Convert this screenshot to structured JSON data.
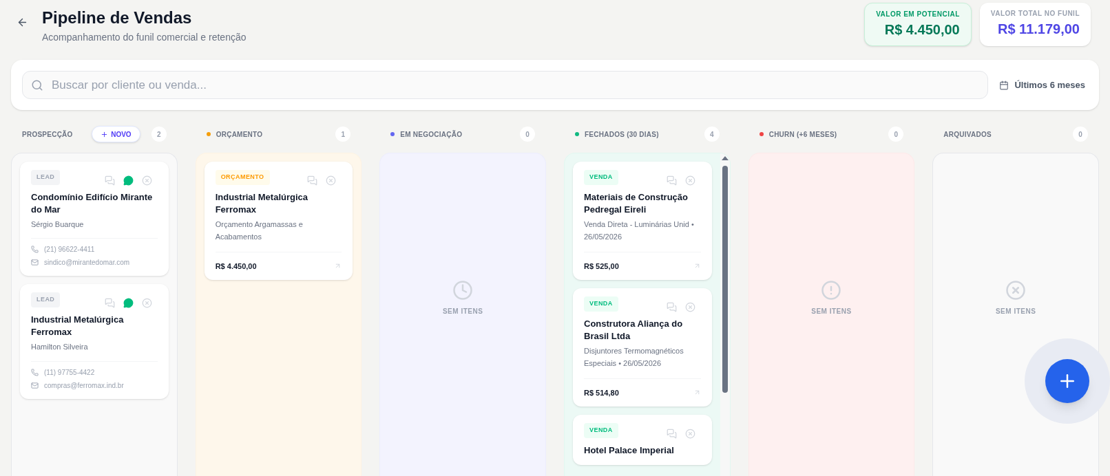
{
  "header": {
    "title": "Pipeline de Vendas",
    "subtitle": "Acompanhamento do funil comercial e retenção"
  },
  "stats": [
    {
      "kind": "potential",
      "label": "VALOR EM POTENCIAL",
      "value": "R$ 4.450,00"
    },
    {
      "kind": "total",
      "label": "VALOR TOTAL NO FUNIL",
      "value": "R$ 11.179,00"
    }
  ],
  "search": {
    "placeholder": "Buscar por cliente ou venda...",
    "period": "Últimos 6 meses"
  },
  "columns": [
    {
      "title": "PROSPECÇÃO",
      "count": "2",
      "new_button": "NOVO",
      "cards": [
        {
          "kind": "lead",
          "badge": "LEAD",
          "title": "Condomínio Edifício Mirante do Mar",
          "contact": "Sérgio Buarque",
          "phone": "(21) 96622-4411",
          "email": "sindico@mirantedomar.com"
        },
        {
          "kind": "lead",
          "badge": "LEAD",
          "title": "Industrial Metalúrgica Ferromax",
          "contact": "Hamilton Silveira",
          "phone": "(11) 97755-4422",
          "email": "compras@ferromax.ind.br"
        }
      ]
    },
    {
      "title": "ORÇAMENTO",
      "count": "1",
      "color": "#f59e0b",
      "cards": [
        {
          "kind": "quote",
          "badge": "ORÇAMENTO",
          "title": "Industrial Metalúrgica Ferromax",
          "description": "Orçamento Argamassas e Acabamentos",
          "amount": "R$ 4.450,00"
        }
      ]
    },
    {
      "title": "EM NEGOCIAÇÃO",
      "count": "0",
      "color": "#6366f1",
      "kind": "clock",
      "empty_text": "SEM ITENS"
    },
    {
      "title": "FECHADOS (30 DIAS)",
      "count": "4",
      "color": "#10b981",
      "scrollbar": true,
      "cards": [
        {
          "kind": "sale",
          "badge": "VENDA",
          "title": "Materiais de Construção Pedregal Eireli",
          "description": "Venda Direta - Luminárias Unid • 26/05/2026",
          "amount": "R$ 525,00"
        },
        {
          "kind": "sale",
          "badge": "VENDA",
          "title": "Construtora Aliança do Brasil Ltda",
          "description": "Disjuntores Termomagnéticos Especiais • 26/05/2026",
          "amount": "R$ 514,80"
        },
        {
          "kind": "sale",
          "badge": "VENDA",
          "title": "Hotel Palace Imperial"
        }
      ]
    },
    {
      "title": "CHURN (+6 MESES)",
      "count": "0",
      "color": "#ef4444",
      "kind": "alert",
      "empty_text": "SEM ITENS"
    },
    {
      "title": "ARQUIVADOS",
      "count": "0",
      "kind": "x",
      "empty_text": "SEM ITENS"
    }
  ]
}
